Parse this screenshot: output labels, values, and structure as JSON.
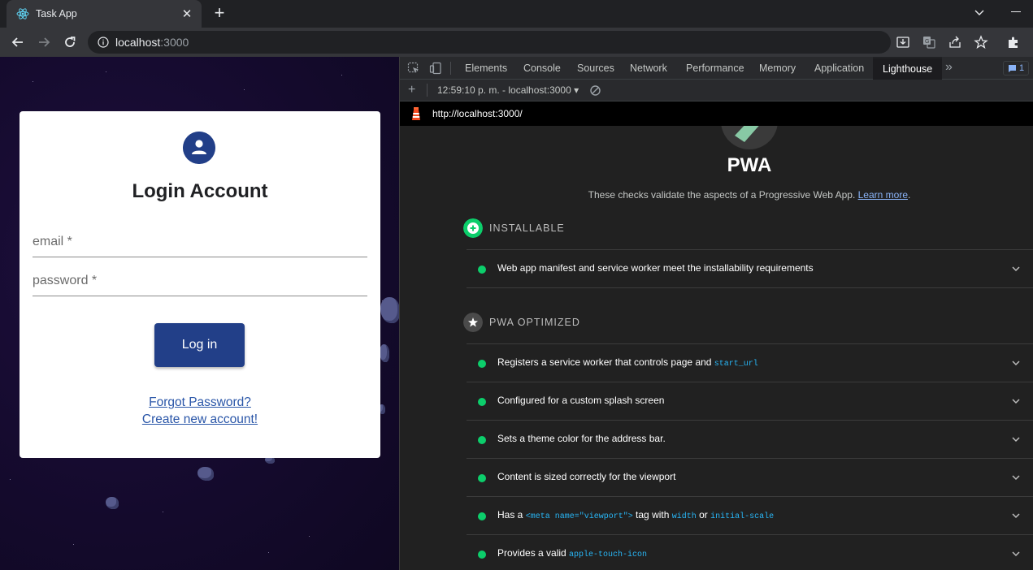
{
  "browser": {
    "tab_title": "Task App",
    "url_host": "localhost",
    "url_port": ":3000"
  },
  "login": {
    "title": "Login Account",
    "email_label": "email *",
    "password_label": "password *",
    "login_button": "Log in",
    "forgot_link": "Forgot Password?",
    "create_link": "Create new account!"
  },
  "devtools": {
    "tabs": [
      "Elements",
      "Console",
      "Sources",
      "Network",
      "Performance",
      "Memory",
      "Application",
      "Lighthouse"
    ],
    "active_tab": "Lighthouse",
    "issues_count": "1",
    "report_label": "12:59:10 p. m. - localhost:3000",
    "lighthouse_url": "http://localhost:3000/"
  },
  "lighthouse": {
    "category_title": "PWA",
    "description": "These checks validate the aspects of a Progressive Web App.",
    "learn_more": "Learn more",
    "groups": [
      {
        "title": "INSTALLABLE"
      },
      {
        "title": "PWA OPTIMIZED"
      }
    ],
    "audits": {
      "a1": {
        "text": "Web app manifest and service worker meet the installability requirements"
      },
      "a2": {
        "pre": "Registers a service worker that controls page and ",
        "code": "start_url"
      },
      "a3": {
        "text": "Configured for a custom splash screen"
      },
      "a4": {
        "text": "Sets a theme color for the address bar."
      },
      "a5": {
        "text": "Content is sized correctly for the viewport"
      },
      "a6": {
        "pre": "Has a ",
        "code1": "<meta name=\"viewport\">",
        "mid1": " tag with ",
        "code2": "width",
        "mid2": " or ",
        "code3": "initial-scale"
      },
      "a7": {
        "pre": "Provides a valid ",
        "code": "apple-touch-icon"
      }
    },
    "pass_color": "#0cce6b"
  }
}
